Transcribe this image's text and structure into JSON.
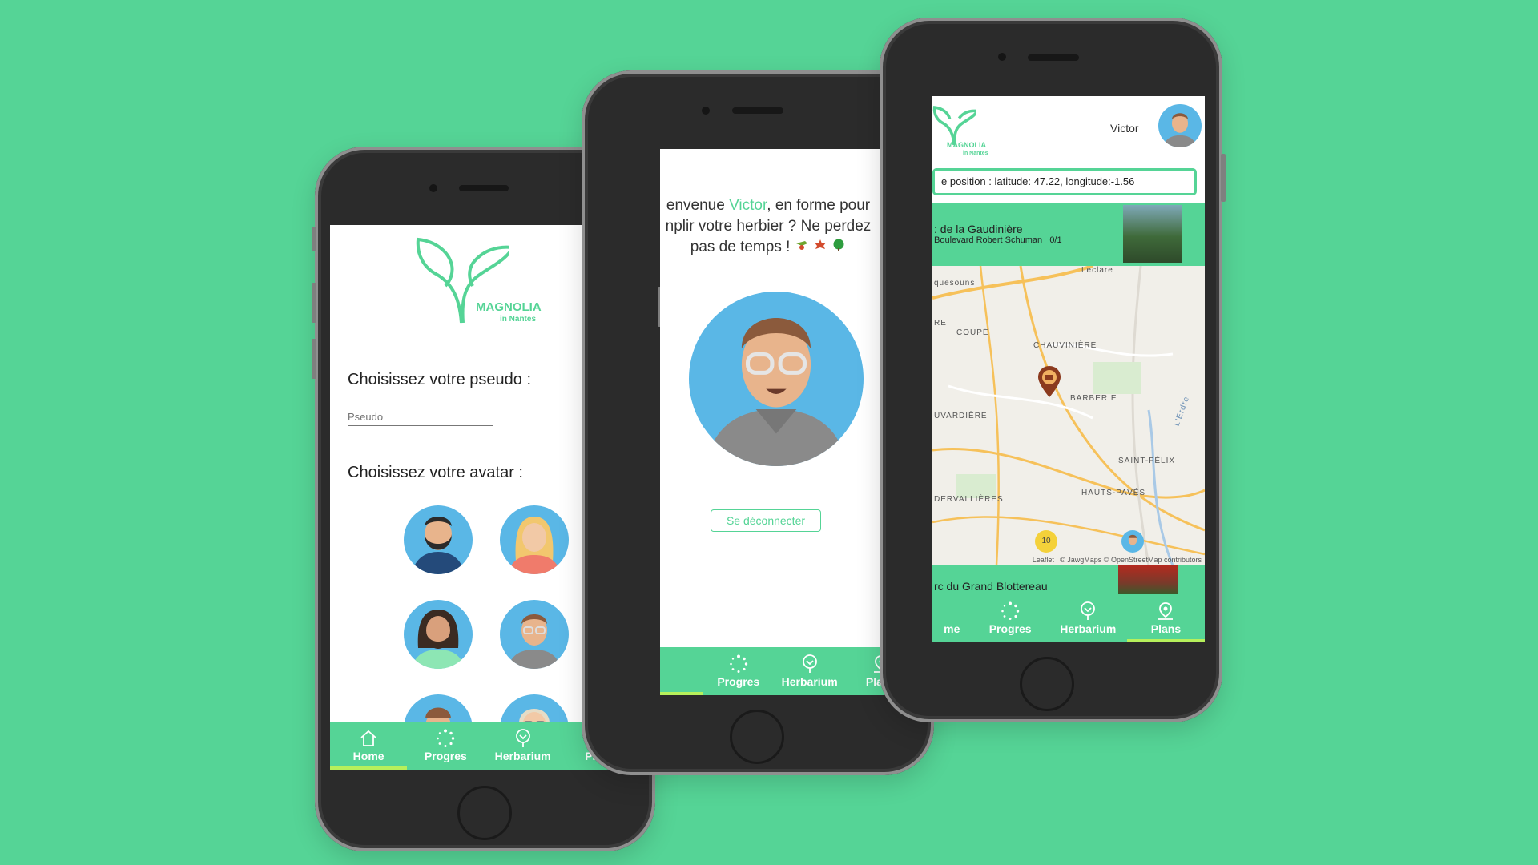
{
  "colors": {
    "background": "#55d496",
    "brand_green": "#55d496",
    "active_tab_underline": "#b6f05b",
    "phone_body": "#2b2b2b"
  },
  "logo": {
    "name": "MAGNOLIA",
    "subtitle": "in Nantes"
  },
  "tabs": [
    {
      "label": "Home",
      "icon": "home-icon"
    },
    {
      "label": "Progres",
      "icon": "progress-icon"
    },
    {
      "label": "Herbarium",
      "icon": "tree-icon"
    },
    {
      "label": "Plans",
      "icon": "map-pin-icon"
    }
  ],
  "tabs_partial": {
    "home_cut": "me"
  },
  "phone1": {
    "pseudo_label": "Choisissez votre pseudo :",
    "pseudo_placeholder": "Pseudo",
    "avatar_label": "Choisissez votre avatar :"
  },
  "phone2": {
    "welcome_prefix": "envenue ",
    "welcome_name": "Victor",
    "welcome_line1_rest": ", en forme pour",
    "welcome_line2": "nplir votre herbier ? Ne perdez",
    "welcome_line3": "pas de temps !",
    "logout_label": "Se déconnecter"
  },
  "phone3": {
    "user_name": "Victor",
    "position_text": "e position : latitude: 47.22, longitude:-1.56",
    "park1_title": ": de la Gaudinière",
    "park1_address": "Boulevard Robert Schuman",
    "park1_count": "0/1",
    "park2_title": "rc du Grand Blottereau",
    "map_attribution": "Leaflet | © JawgMaps © OpenStreetMap contributors",
    "map_labels": [
      "quesouns",
      "COUPÉ",
      "CHAUVINIÈRE",
      "BARBERIE",
      "UVARDIÈRE",
      "SAINT-FÉLIX",
      "HAUTS-PAVÉS",
      "DERVALLIÈRES",
      "L'Erdre",
      "Leclare",
      "RE"
    ],
    "cluster_count": "10"
  }
}
